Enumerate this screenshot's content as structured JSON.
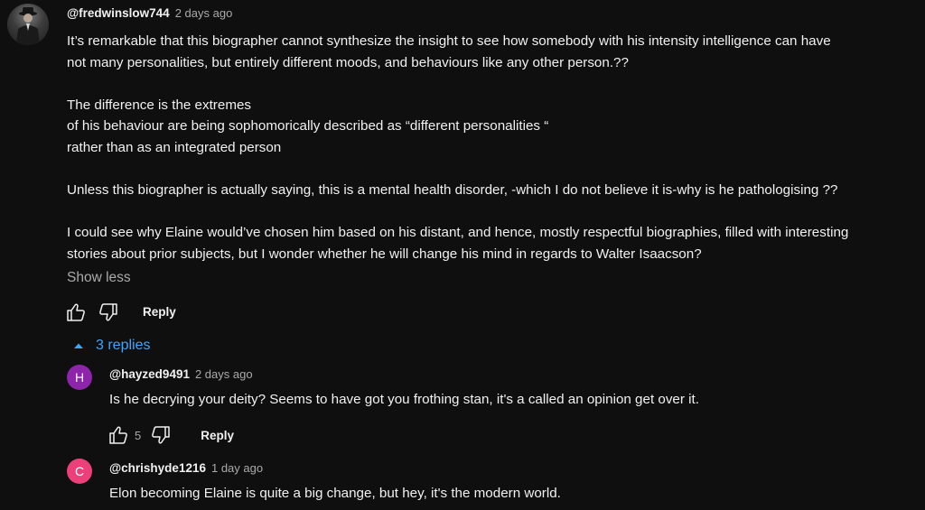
{
  "colors": {
    "background": "#0f0f0f",
    "link_blue": "#3ea6ff",
    "avatar_h": "#8e24aa",
    "avatar_c": "#ec407a"
  },
  "comment": {
    "author": "@fredwinslow744",
    "time": "2 days ago",
    "paragraphs": [
      [
        "It’s remarkable that this biographer cannot synthesize the insight to see how somebody with his intensity intelligence can have",
        "not many personalities, but entirely different moods, and behaviours like any other person.??"
      ],
      [
        "The difference is the extremes",
        "of his behaviour are being sophomorically described as “different personalities “",
        "rather than as an integrated person"
      ],
      [
        "Unless this biographer is actually saying, this is a mental health disorder, -which I do not believe it is-why is he pathologising ??"
      ],
      [
        "I could see why Elaine would’ve chosen him based on his distant, and hence, mostly respectful biographies, filled with interesting",
        "stories about prior subjects, but I wonder whether he will change his mind in regards to Walter Isaacson?"
      ]
    ],
    "show_less": "Show less",
    "reply_label": "Reply",
    "avatar_icon": "user-photo-avatar"
  },
  "replies_toggle": {
    "label": "3 replies",
    "icon": "chevron-up-icon"
  },
  "replies": [
    {
      "avatar_letter": "H",
      "author": "@hayzed9491",
      "time": "2 days ago",
      "text": "Is he decrying your deity? Seems to have got you frothing stan, it's a called an opinion get over it.",
      "likes": "5",
      "reply_label": "Reply"
    },
    {
      "avatar_letter": "C",
      "author": "@chrishyde1216",
      "time": "1 day ago",
      "text": "Elon becoming Elaine is quite a big change, but hey, it's the modern world."
    }
  ]
}
